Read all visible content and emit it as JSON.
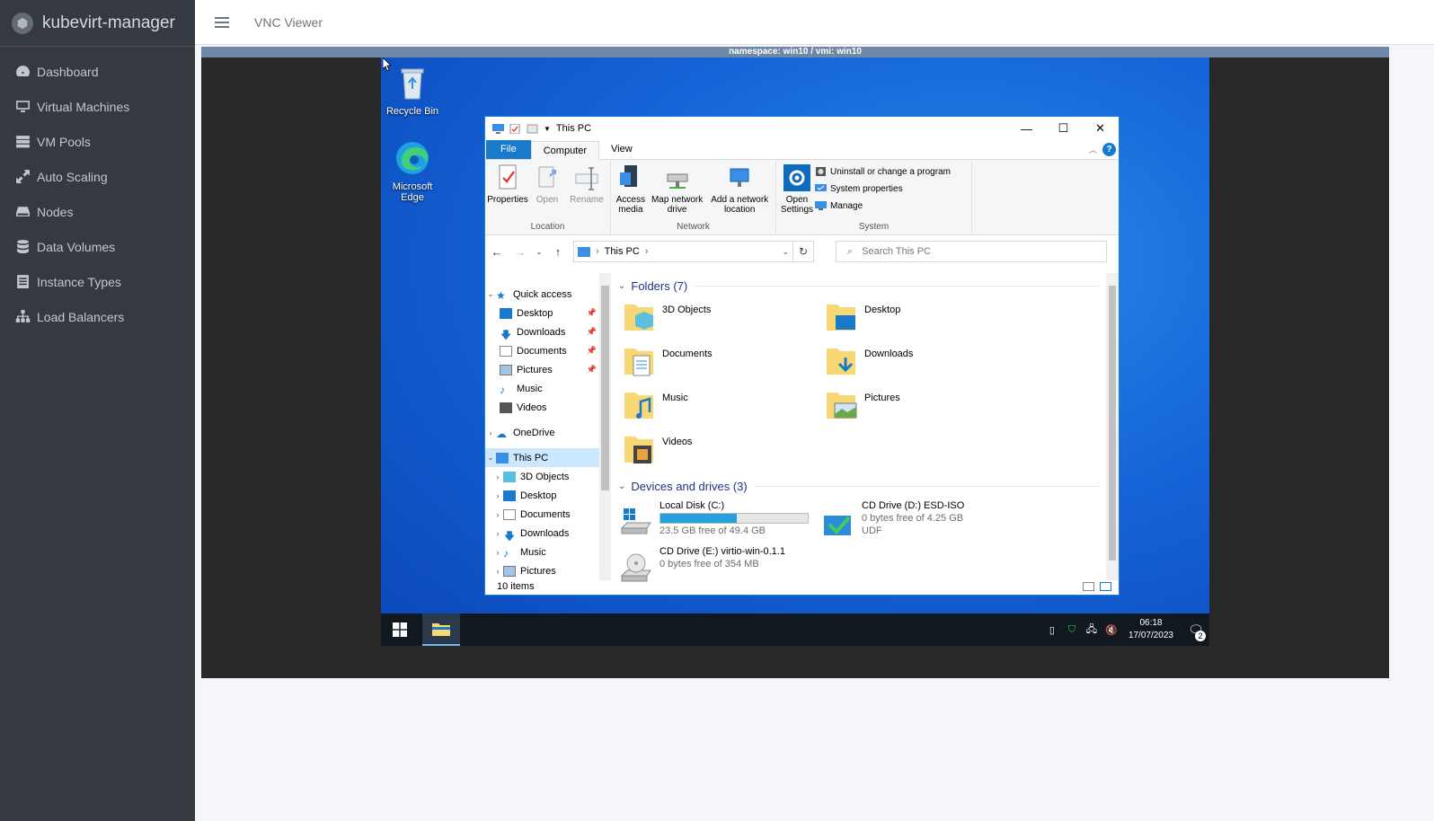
{
  "app": {
    "name": "kubevirt-manager"
  },
  "sidebar": {
    "items": [
      {
        "label": "Dashboard",
        "icon": "tachometer-icon"
      },
      {
        "label": "Virtual Machines",
        "icon": "desktop-icon"
      },
      {
        "label": "VM Pools",
        "icon": "server-icon"
      },
      {
        "label": "Auto Scaling",
        "icon": "expand-icon"
      },
      {
        "label": "Nodes",
        "icon": "hdd-icon"
      },
      {
        "label": "Data Volumes",
        "icon": "database-icon"
      },
      {
        "label": "Instance Types",
        "icon": "list-icon"
      },
      {
        "label": "Load Balancers",
        "icon": "sitemap-icon"
      }
    ]
  },
  "topbar": {
    "title": "VNC Viewer"
  },
  "vnc": {
    "status": "namespace: win10 / vmi: win10"
  },
  "desktop": {
    "icons": [
      {
        "label": "Recycle Bin"
      },
      {
        "label": "Microsoft Edge"
      }
    ]
  },
  "explorer": {
    "title": "This PC",
    "tabs": {
      "file": "File",
      "computer": "Computer",
      "view": "View"
    },
    "ribbon": {
      "location": {
        "label": "Location",
        "properties": "Properties",
        "open": "Open",
        "rename": "Rename"
      },
      "network": {
        "label": "Network",
        "access_media": "Access media",
        "map_drive": "Map network drive",
        "add_location": "Add a network location"
      },
      "system": {
        "label": "System",
        "open_settings": "Open Settings",
        "uninstall": "Uninstall or change a program",
        "system_properties": "System properties",
        "manage": "Manage"
      }
    },
    "address": {
      "path": "This PC",
      "search_placeholder": "Search This PC"
    },
    "nav_pane": {
      "quick_access": "Quick access",
      "quick_items": [
        "Desktop",
        "Downloads",
        "Documents",
        "Pictures",
        "Music",
        "Videos"
      ],
      "onedrive": "OneDrive",
      "this_pc": "This PC",
      "pc_items": [
        "3D Objects",
        "Desktop",
        "Documents",
        "Downloads",
        "Music",
        "Pictures"
      ]
    },
    "folders": {
      "header": "Folders (7)",
      "items": [
        "3D Objects",
        "Desktop",
        "Documents",
        "Downloads",
        "Music",
        "Pictures",
        "Videos"
      ]
    },
    "drives": {
      "header": "Devices and drives (3)",
      "items": [
        {
          "name": "Local Disk (C:)",
          "detail": "23.5 GB free of 49.4 GB",
          "used_fraction": 0.52
        },
        {
          "name": "CD Drive (D:) ESD-ISO",
          "detail": "0 bytes free of 4.25 GB",
          "fs": "UDF"
        },
        {
          "name": "CD Drive (E:) virtio-win-0.1.1",
          "detail": "0 bytes free of 354 MB"
        }
      ]
    },
    "status": "10 items"
  },
  "taskbar": {
    "time": "06:18",
    "date": "17/07/2023",
    "notifications": "2"
  },
  "colors": {
    "sidebar_bg": "#343a40",
    "accent": "#1979ca",
    "taskbar": "#101820"
  }
}
